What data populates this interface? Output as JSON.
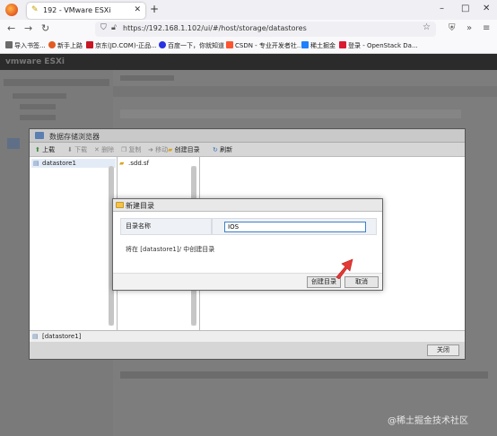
{
  "browser": {
    "tab_title": "192 - VMware ESXi",
    "tab_close": "✕",
    "new_tab": "+",
    "window_controls": [
      "–",
      "□",
      "✕"
    ],
    "url": "https://192.168.1.102/ui/#/host/storage/datastores",
    "bookmarks": [
      {
        "label": "导入书签...",
        "icon_color": "#6b6b6b"
      },
      {
        "label": "新手上路",
        "icon_color": "#e25a22"
      },
      {
        "label": "京东(JD.COM)-正品...",
        "icon_color": "#c81623"
      },
      {
        "label": "百度一下，你就知道",
        "icon_color": "#2932e1"
      },
      {
        "label": "CSDN - 专业开发者社...",
        "icon_color": "#fc5531"
      },
      {
        "label": "稀土掘金",
        "icon_color": "#1e80ff"
      },
      {
        "label": "登录 - OpenStack Da...",
        "icon_color": "#da1a32"
      }
    ]
  },
  "app": {
    "logo": "vmware ESXi"
  },
  "browse_dialog": {
    "title": "数据存储浏览器",
    "toolbar": {
      "upload": "上载",
      "download": "下载",
      "delete": "删除",
      "copy": "复制",
      "move": "移动",
      "create_dir": "创建目录",
      "refresh": "刷新"
    },
    "datastore": "datastore1",
    "files": [
      ".sdd.sf"
    ],
    "path": "[datastore1]",
    "close": "关闭"
  },
  "new_dir_dialog": {
    "title": "新建目录",
    "field_label": "目录名称",
    "field_value": "IOS",
    "hint": "将在 [datastore1]/ 中创建目录",
    "create_button": "创建目录",
    "cancel_button": "取消"
  },
  "watermark": "@稀土掘金技术社区",
  "colors": {
    "arrow": "#e53935",
    "input_focus": "#3d7fc8"
  }
}
